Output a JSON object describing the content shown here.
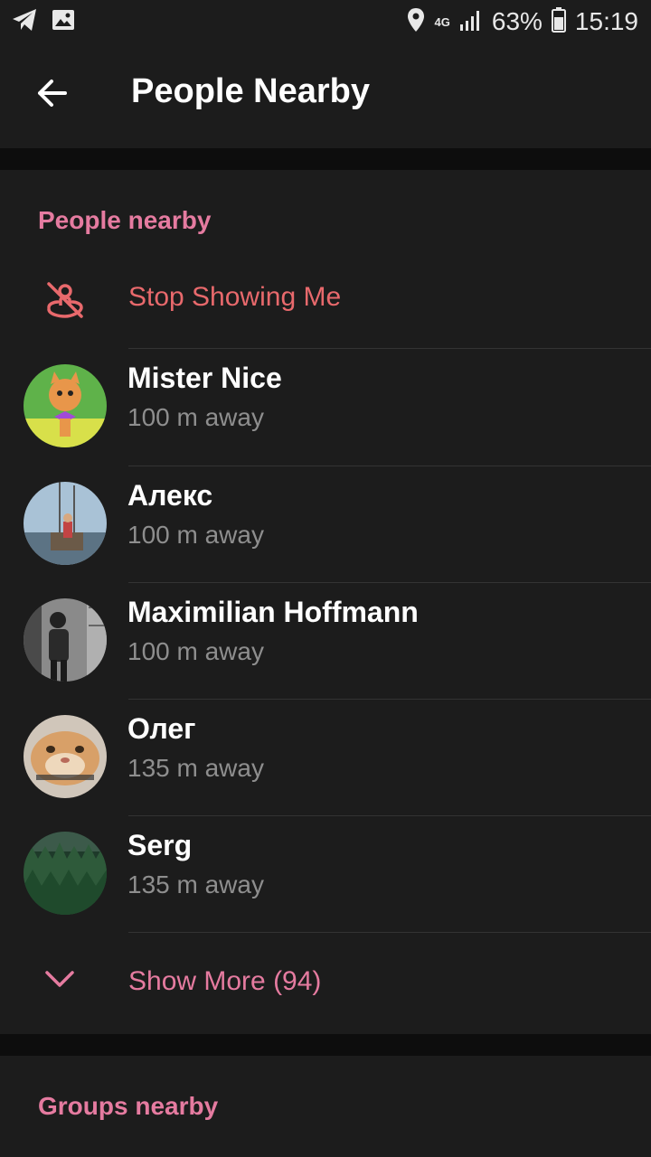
{
  "status_bar": {
    "network": "4G",
    "battery": "63%",
    "time": "15:19"
  },
  "app_bar": {
    "title": "People Nearby"
  },
  "people_section": {
    "header": "People nearby",
    "stop_showing_label": "Stop Showing Me",
    "people": [
      {
        "name": "Mister Nice",
        "distance": "100 m away"
      },
      {
        "name": "Алекс",
        "distance": "100 m away"
      },
      {
        "name": "Maximilian Hoffmann",
        "distance": "100 m away"
      },
      {
        "name": "Олег",
        "distance": "135 m away"
      },
      {
        "name": "Serg",
        "distance": "135 m away"
      }
    ],
    "show_more_label": "Show More (94)"
  },
  "groups_section": {
    "header": "Groups nearby"
  },
  "colors": {
    "accent": "#e57ba0",
    "danger": "#e8696c",
    "surface": "#1c1c1c",
    "background": "#0d0d0d",
    "secondary_text": "#8e8e8e"
  }
}
